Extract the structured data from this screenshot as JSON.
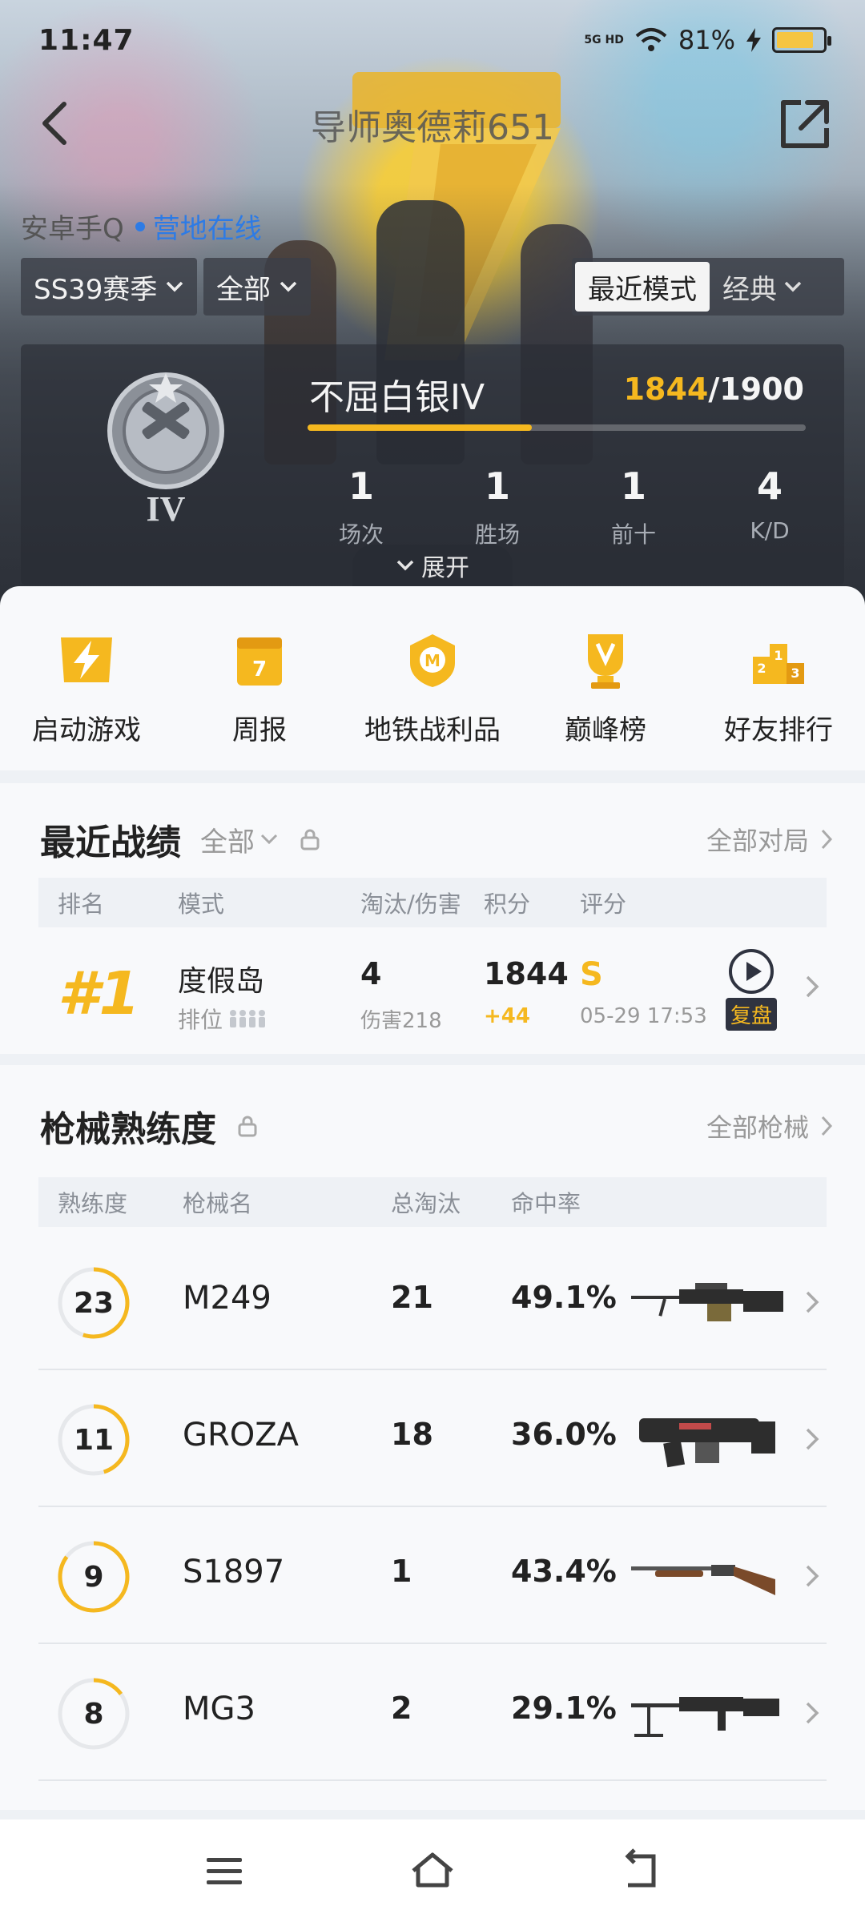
{
  "status_bar": {
    "time": "11:47",
    "network": "5G HD",
    "battery": "81%",
    "battery_level": 0.81
  },
  "nav": {
    "title": "导师奥德莉651"
  },
  "player": {
    "platform": "安卓手Q",
    "status": "营地在线"
  },
  "filters": {
    "season": "SS39赛季",
    "scope": "全部",
    "mode_active": "最近模式",
    "mode_other": "经典"
  },
  "rank": {
    "tier": "不屈白银IV",
    "tier_roman": "IV",
    "points": "1844",
    "points_max": "/1900",
    "progress": 0.45,
    "stats": [
      {
        "value": "1",
        "label": "场次"
      },
      {
        "value": "1",
        "label": "胜场"
      },
      {
        "value": "1",
        "label": "前十"
      },
      {
        "value": "4",
        "label": "K/D"
      }
    ],
    "expand": "展开"
  },
  "quick_actions": [
    {
      "label": "启动游戏",
      "icon": "lightning-icon"
    },
    {
      "label": "周报",
      "icon": "calendar-icon"
    },
    {
      "label": "地铁战利品",
      "icon": "metro-badge-icon"
    },
    {
      "label": "巅峰榜",
      "icon": "trophy-icon"
    },
    {
      "label": "好友排行",
      "icon": "podium-icon"
    }
  ],
  "recent": {
    "title": "最近战绩",
    "filter": "全部",
    "more": "全部对局",
    "headers": [
      "排名",
      "模式",
      "淘汰/伤害",
      "积分",
      "评分"
    ],
    "match": {
      "rank": "#1",
      "map": "度假岛",
      "mode": "排位",
      "kills": "4",
      "damage": "伤害218",
      "score": "1844",
      "delta": "+44",
      "grade": "S",
      "time": "05-29 17:53",
      "replay": "复盘"
    }
  },
  "weapons": {
    "title": "枪械熟练度",
    "more": "全部枪械",
    "headers": [
      "熟练度",
      "枪械名",
      "总淘汰",
      "命中率"
    ],
    "rows": [
      {
        "level": "23",
        "name": "M249",
        "kills": "21",
        "rate": "49.1%",
        "progress": 0.55
      },
      {
        "level": "11",
        "name": "GROZA",
        "kills": "18",
        "rate": "36.0%",
        "progress": 0.45
      },
      {
        "level": "9",
        "name": "S1897",
        "kills": "1",
        "rate": "43.4%",
        "progress": 0.85
      },
      {
        "level": "8",
        "name": "MG3",
        "kills": "2",
        "rate": "29.1%",
        "progress": 0.15
      }
    ]
  },
  "colors": {
    "accent": "#f5b81f",
    "link": "#2d7be5"
  }
}
